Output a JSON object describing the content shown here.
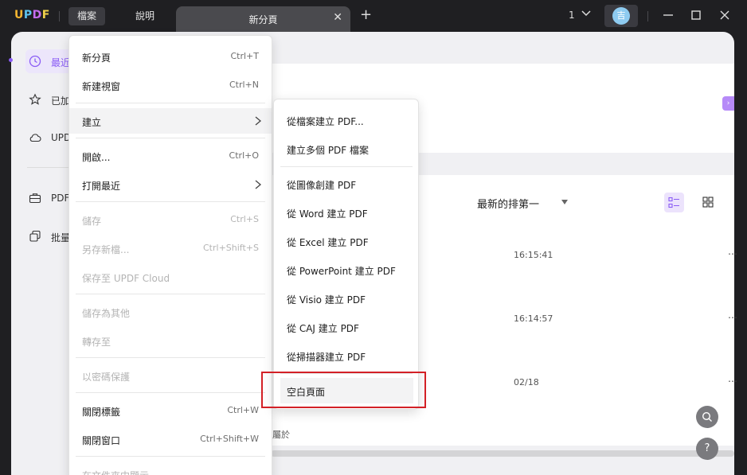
{
  "titlebar": {
    "logo": {
      "letters": [
        "U",
        "P",
        "D",
        "F"
      ],
      "colors": [
        "#f5b631",
        "#5ec5f0",
        "#c56cf0",
        "#f0d14a"
      ]
    },
    "menus": [
      {
        "label": "檔案"
      },
      {
        "label": "說明"
      }
    ],
    "tab": {
      "label": "新分頁",
      "close": "✕"
    },
    "add_tab": "+",
    "page_count": "1",
    "avatar": "吉"
  },
  "sidebar": {
    "items": [
      {
        "label": "最近",
        "icon": "clock-icon"
      },
      {
        "label": "已加",
        "icon": "star-icon"
      },
      {
        "label": "UPD",
        "icon": "cloud-icon"
      },
      {
        "label": "PDF",
        "icon": "briefcase-icon"
      },
      {
        "label": "批量",
        "icon": "copy-icon"
      }
    ]
  },
  "content": {
    "sort_label": "最新的排第一",
    "rows": [
      {
        "time": "16:15:41"
      },
      {
        "time": "16:14:57"
      },
      {
        "time": "02/18"
      }
    ],
    "partial_text": "屬於",
    "more": "⋯",
    "search_btn": "⌕",
    "help_btn": "?",
    "collapse_tab": "›"
  },
  "file_menu": {
    "items": [
      {
        "label": "新分頁",
        "shortcut": "Ctrl+T"
      },
      {
        "label": "新建視窗",
        "shortcut": "Ctrl+N"
      },
      {
        "label": "建立",
        "shortcut": ""
      },
      {
        "label": "開啟...",
        "shortcut": "Ctrl+O"
      },
      {
        "label": "打開最近",
        "shortcut": ""
      },
      {
        "label": "儲存",
        "shortcut": "Ctrl+S"
      },
      {
        "label": "另存新檔...",
        "shortcut": "Ctrl+Shift+S"
      },
      {
        "label": "保存至 UPDF Cloud",
        "shortcut": ""
      },
      {
        "label": "儲存為其他",
        "shortcut": ""
      },
      {
        "label": "轉存至",
        "shortcut": ""
      },
      {
        "label": "以密碼保護",
        "shortcut": ""
      },
      {
        "label": "關閉標籤",
        "shortcut": "Ctrl+W"
      },
      {
        "label": "關閉窗口",
        "shortcut": "Ctrl+Shift+W"
      },
      {
        "label": "在文件夾中顯示",
        "shortcut": ""
      }
    ]
  },
  "create_submenu": {
    "items": [
      {
        "label": "從檔案建立 PDF..."
      },
      {
        "label": "建立多個 PDF 檔案"
      },
      {
        "label": "從圖像創建 PDF"
      },
      {
        "label": "從 Word 建立 PDF"
      },
      {
        "label": "從 Excel 建立 PDF"
      },
      {
        "label": "從 PowerPoint 建立 PDF"
      },
      {
        "label": "從 Visio 建立 PDF"
      },
      {
        "label": "從 CAJ 建立 PDF"
      },
      {
        "label": "從掃描器建立 PDF"
      },
      {
        "label": "空白頁面"
      }
    ]
  },
  "colors": {
    "accent": "#8a5cf5",
    "highlight": "#d32026"
  }
}
